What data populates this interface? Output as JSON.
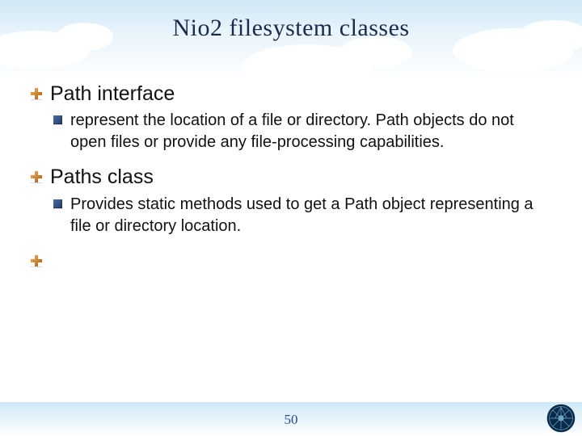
{
  "title": "Nio2 filesystem classes",
  "items": [
    {
      "label": "Path interface",
      "sub": [
        "represent the location of a file or directory. Path objects do not open files or provide any file-processing capabilities."
      ]
    },
    {
      "label": "Paths class",
      "sub": [
        "Provides static methods used to get a Path object representing a file or directory location."
      ]
    },
    {
      "label": "",
      "sub": []
    }
  ],
  "page_number": "50",
  "icons": {
    "l1_bullet": "plus-icon",
    "l2_bullet": "square-icon",
    "seal": "university-seal-icon"
  },
  "colors": {
    "sky": "#cfe8f7",
    "accent_orange": "#c97a23",
    "accent_blue": "#2a4a8a",
    "seal": "#0a2a4a"
  }
}
